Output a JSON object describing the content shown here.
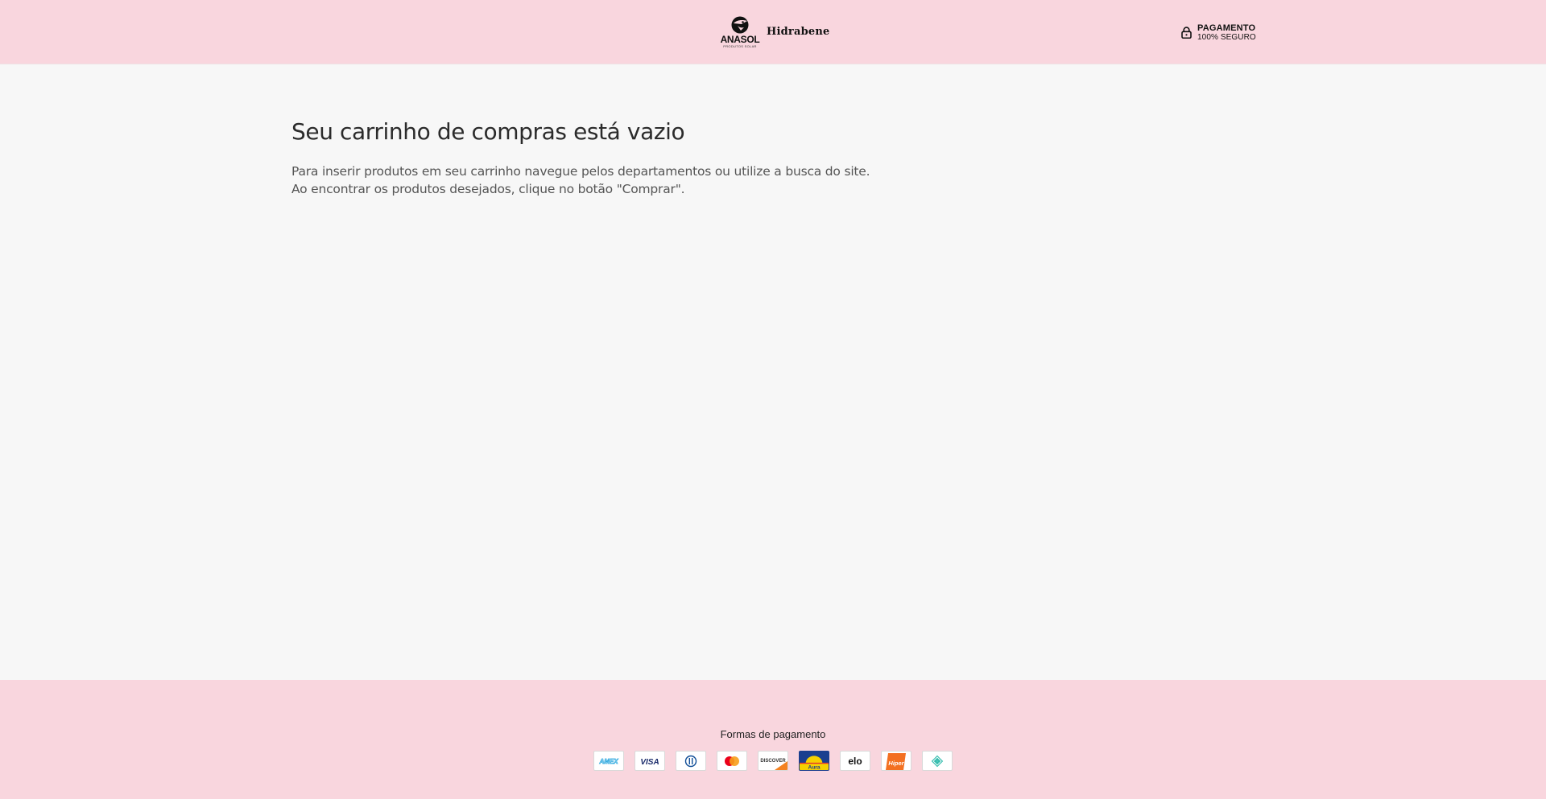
{
  "header": {
    "brand": {
      "anasol_wordmark": "ANASOL",
      "anasol_tagline": "PRODUTOS SOLAR",
      "hidrabene_wordmark": "Hidrabene",
      "icon": "anasol-logo-icon"
    },
    "secure_badge": {
      "line1": "PAGAMENTO",
      "line2": "100% SEGURO",
      "icon": "lock-icon"
    }
  },
  "main": {
    "title": "Seu carrinho de compras está vazio",
    "text_line1": "Para inserir produtos em seu carrinho navegue pelos departamentos ou utilize a busca do site.",
    "text_line2": "Ao encontrar os produtos desejados, clique no botão \"Comprar\"."
  },
  "footer": {
    "payment_title": "Formas de pagamento",
    "payment_methods": [
      {
        "name": "amex",
        "label": "AMEX"
      },
      {
        "name": "visa",
        "label": "VISA"
      },
      {
        "name": "diners",
        "label": ""
      },
      {
        "name": "mastercard",
        "label": ""
      },
      {
        "name": "discover",
        "label": "DISCOVER"
      },
      {
        "name": "aura",
        "label": "Aura"
      },
      {
        "name": "elo",
        "label": "elo"
      },
      {
        "name": "hipercard",
        "label": "Hiper"
      },
      {
        "name": "pix",
        "label": ""
      }
    ]
  },
  "colors": {
    "header_bg": "#f9d6de",
    "body_bg": "#f7f7f7",
    "footer_bg": "#f9d6de"
  }
}
